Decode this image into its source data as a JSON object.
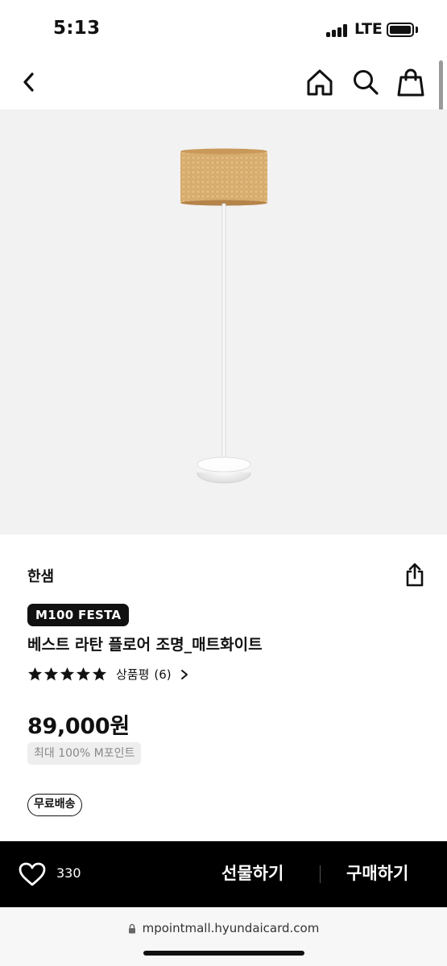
{
  "status_bar": {
    "time": "5:13",
    "network": "LTE",
    "signal_icon": "signal-bars-icon",
    "battery_icon": "battery-icon",
    "battery_level": 1.0
  },
  "nav": {
    "back_icon": "back-chevron-icon",
    "home_icon": "home-icon",
    "search_icon": "search-icon",
    "cart_icon": "shopping-bag-icon"
  },
  "product": {
    "image_icon": "floor-lamp-image",
    "brand": "한샘",
    "share_icon": "share-icon",
    "promo_badge": "M100 FESTA",
    "title": "베스트 라탄 플로어 조명_매트화이트",
    "rating": 5,
    "review_label": "상품평",
    "review_count": "(6)",
    "price": "89,000원",
    "points_badge": "최대 100% M포인트",
    "shipping_badge": "무료배송"
  },
  "action_bar": {
    "like_icon": "heart-icon",
    "like_count": "330",
    "gift_label": "선물하기",
    "buy_label": "구매하기"
  },
  "browser": {
    "url": "mpointmall.hyundaicard.com"
  },
  "colors": {
    "background": "#ffffff",
    "hero_background": "#f2f2f2",
    "action_bar": "#000000",
    "points_badge_bg": "#eeeeee",
    "rattan": "#d4a868"
  }
}
